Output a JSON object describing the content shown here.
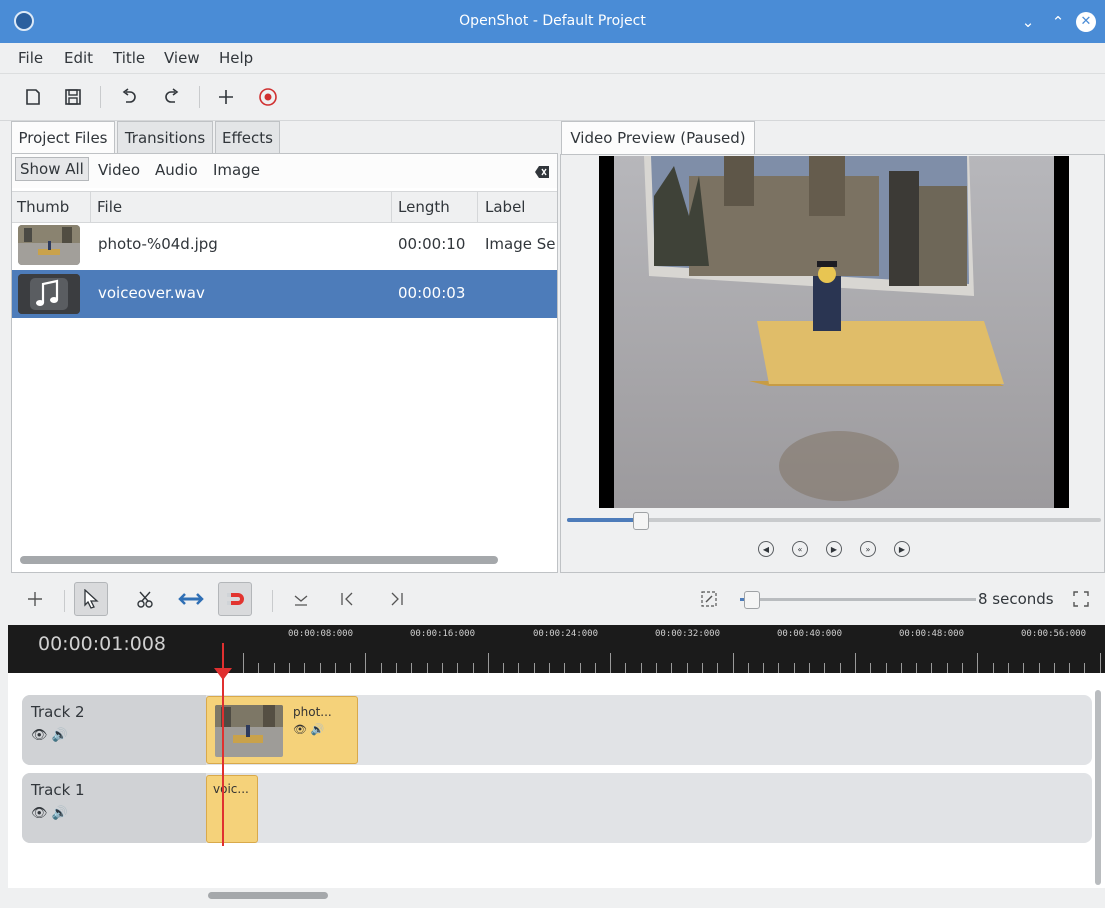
{
  "window": {
    "title": "OpenShot - Default Project"
  },
  "menu": [
    "File",
    "Edit",
    "Title",
    "View",
    "Help"
  ],
  "project_panel": {
    "tabs": [
      "Project Files",
      "Transitions",
      "Effects"
    ],
    "filters": [
      "Show All",
      "Video",
      "Audio",
      "Image"
    ],
    "columns": [
      "Thumb",
      "File",
      "Length",
      "Label"
    ],
    "rows": [
      {
        "file": "photo-%04d.jpg",
        "length": "00:00:10",
        "label": "Image Se",
        "thumb": "photo-thumbnail",
        "selected": false
      },
      {
        "file": "voiceover.wav",
        "length": "00:00:03",
        "label": "",
        "thumb": "music-note-icon",
        "selected": true
      }
    ]
  },
  "preview": {
    "tab": "Video Preview (Paused)",
    "seek_fraction": 0.13
  },
  "timeline": {
    "timecode": "00:00:01:008",
    "zoom_label": "8 seconds",
    "ruler_labels": [
      "00:00:08:000",
      "00:00:16:000",
      "00:00:24:000",
      "00:00:32:000",
      "00:00:40:000",
      "00:00:48:000",
      "00:00:56:000"
    ],
    "tracks": [
      {
        "name": "Track 2",
        "clip_label": "phot..."
      },
      {
        "name": "Track 1",
        "clip_label": "voic..."
      }
    ]
  },
  "colors": {
    "titlebar": "#4a8cd6",
    "selection": "#4d7cba",
    "clip": "#f5d27a",
    "playhead": "#e03030"
  }
}
